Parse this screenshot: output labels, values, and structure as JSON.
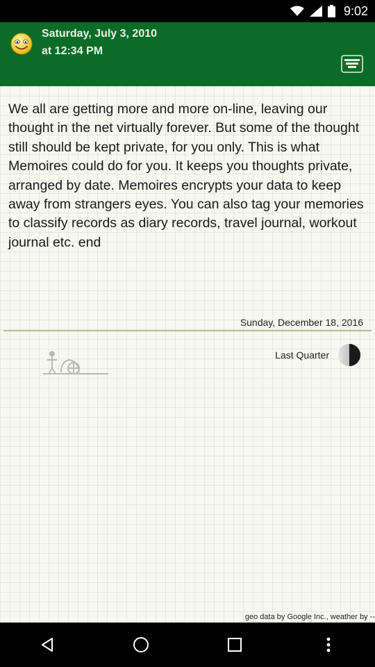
{
  "status_bar": {
    "time": "9:02",
    "icons": [
      "wifi-icon",
      "signal-icon",
      "battery-icon"
    ]
  },
  "header": {
    "date": "Saturday, July 3, 2010",
    "time": "at 12:34 PM",
    "mood_icon": "smiley-icon",
    "menu_icon": "tag-menu-icon",
    "bg_color": "#0b6b27"
  },
  "entry": {
    "body": "We all are getting more and more on-line, leaving our thought in the net virtually forever. But some of the thought still should be kept private, for you only. This is what Memoires could do for you. It keeps you thoughts private, arranged by date. Memoires encrypts your data to keep away from strangers eyes. You can also tag your memories to classify records as diary records, travel journal, workout journal etc. end",
    "date": "Sunday, December 18, 2016",
    "moon_phase": "Last Quarter",
    "weather_icon": "weather-station-icon",
    "footer": "geo data by Google Inc., weather by --"
  },
  "nav_bar": {
    "icons": [
      "back-icon",
      "home-icon",
      "recents-icon",
      "more-icon"
    ]
  }
}
